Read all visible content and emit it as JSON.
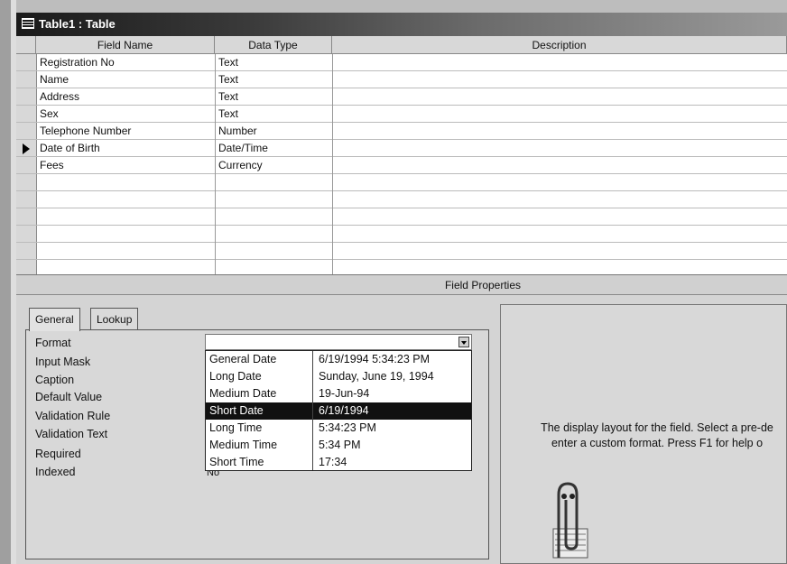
{
  "window": {
    "title": "Table1 : Table"
  },
  "grid": {
    "columns": [
      "Field Name",
      "Data Type",
      "Description"
    ],
    "rows": [
      {
        "field": "Registration No",
        "type": "Text",
        "description": ""
      },
      {
        "field": "Name",
        "type": "Text",
        "description": ""
      },
      {
        "field": "Address",
        "type": "Text",
        "description": ""
      },
      {
        "field": "Sex",
        "type": "Text",
        "description": ""
      },
      {
        "field": "Telephone Number",
        "type": "Number",
        "description": ""
      },
      {
        "field": "Date of Birth",
        "type": "Date/Time",
        "description": ""
      },
      {
        "field": "Fees",
        "type": "Currency",
        "description": ""
      }
    ],
    "current_row_index": 5,
    "row_selector_icon": "current-row-arrow-icon"
  },
  "field_properties": {
    "heading": "Field Properties",
    "tabs": [
      {
        "label": "General",
        "active": true
      },
      {
        "label": "Lookup",
        "active": false
      }
    ],
    "labels": {
      "format": "Format",
      "input_mask": "Input Mask",
      "caption": "Caption",
      "default_value": "Default Value",
      "validation_rule": "Validation Rule",
      "validation_text": "Validation Text",
      "required": "Required",
      "indexed": "Indexed"
    },
    "indexed_value": "No",
    "format_value": "",
    "format_options": [
      {
        "name": "General Date",
        "example": "6/19/1994 5:34:23 PM"
      },
      {
        "name": "Long Date",
        "example": "Sunday, June 19, 1994"
      },
      {
        "name": "Medium Date",
        "example": "19-Jun-94"
      },
      {
        "name": "Short Date",
        "example": "6/19/1994"
      },
      {
        "name": "Long Time",
        "example": "5:34:23 PM"
      },
      {
        "name": "Medium Time",
        "example": "5:34 PM"
      },
      {
        "name": "Short Time",
        "example": "17:34"
      }
    ],
    "selected_option_index": 3,
    "help_text_line1": "The display layout for the field.  Select a pre-de",
    "help_text_line2": "enter a custom format.  Press F1 for help o",
    "assistant_icon": "office-assistant-paperclip-icon"
  },
  "colors": {
    "selection": "#111111",
    "grid_bg": "#ffffff",
    "panel_bg": "#d4d4d4"
  }
}
